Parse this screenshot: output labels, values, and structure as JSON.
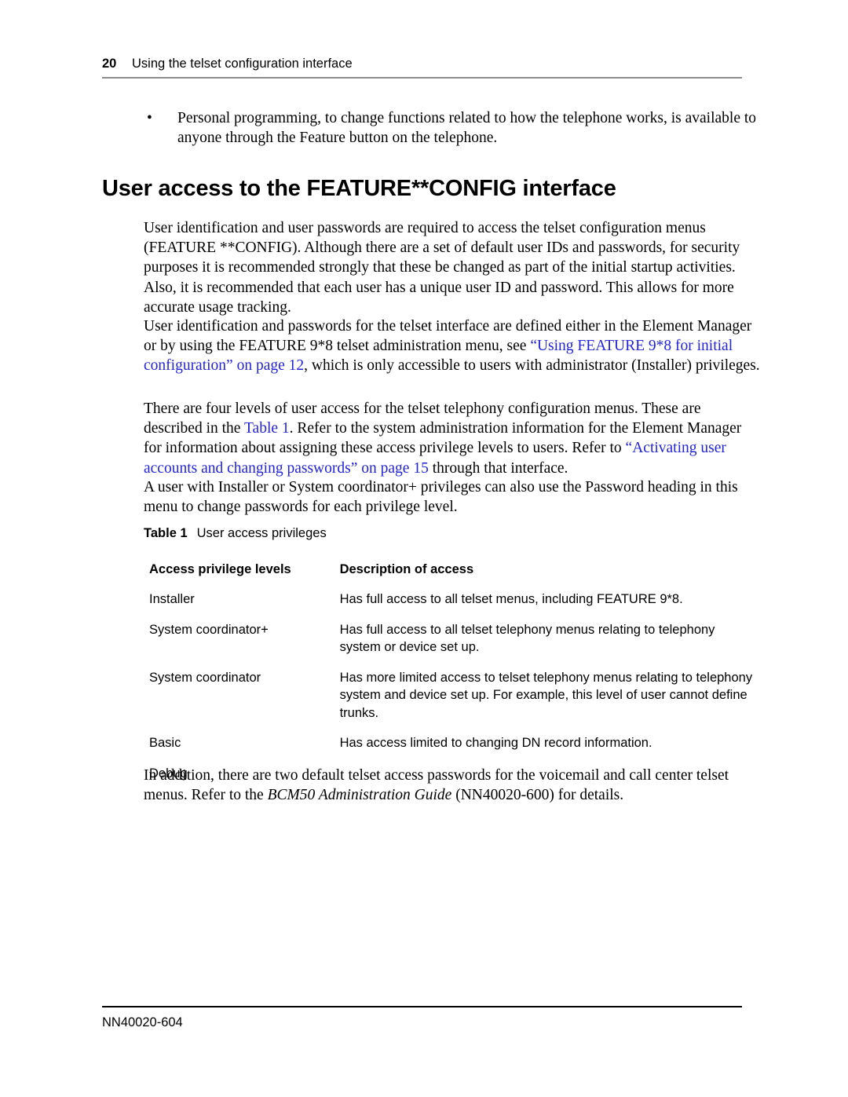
{
  "header": {
    "page_number": "20",
    "chapter_title": "Using the telset configuration interface"
  },
  "bullets": [
    "Personal programming, to change functions related to how the telephone works, is available to anyone through the Feature button on the telephone."
  ],
  "section": {
    "title": "User access to the FEATURE**CONFIG interface"
  },
  "paragraphs": {
    "p1": "User identification and user passwords are required to access the telset configuration menus (FEATURE **CONFIG). Although there are a set of default user IDs and passwords, for security purposes it is recommended strongly that these be changed as part of the initial startup activities. Also, it is recommended that each user has a unique user ID and password. This allows for more accurate usage tracking.",
    "p2_before": "User identification and passwords for the telset interface are defined either in the Element Manager or by using the FEATURE 9*8 telset administration menu, see ",
    "p2_link": "“Using FEATURE 9*8 for initial configuration” on page 12",
    "p2_after": ", which is only accessible to users with administrator (Installer) privileges.",
    "p3_before": "There are four levels of user access for the telset telephony configuration menus. These are described in the ",
    "p3_link1": "Table 1",
    "p3_middle": ". Refer to the system administration information for the Element Manager for information about assigning these access privilege levels to users. Refer to ",
    "p3_link2": "“Activating user accounts and changing passwords” on page 15",
    "p3_after": " through that interface.",
    "p4": "A user with Installer or System coordinator+ privileges can also use the Password heading in this menu to change passwords for each privilege level.",
    "p5_before": "In addition, there are two default telset access passwords for the voicemail and call center telset menus. Refer to the ",
    "p5_italic": "BCM50 Administration Guide",
    "p5_after": " (NN40020-600) for details."
  },
  "table": {
    "caption_label": "Table 1",
    "caption_text": "User access privileges",
    "columns": [
      "Access privilege levels",
      "Description of access"
    ],
    "rows": [
      {
        "level": "Installer",
        "description": "Has full access to all telset menus, including FEATURE 9*8."
      },
      {
        "level": "System coordinator+",
        "description": "Has full access to all telset telephony menus relating to telephony system or device set up."
      },
      {
        "level": "System coordinator",
        "description": "Has more limited access to telset telephony menus relating to telephony system and device set up. For example, this level of user cannot define trunks."
      },
      {
        "level": "Basic",
        "description": "Has access limited to changing DN record information."
      },
      {
        "level": "Debug",
        "description": ""
      }
    ]
  },
  "footer": {
    "document_number": "NN40020-604"
  },
  "colors": {
    "link": "#2323db",
    "header_rule": "#8c8c8c",
    "text": "#000000"
  }
}
